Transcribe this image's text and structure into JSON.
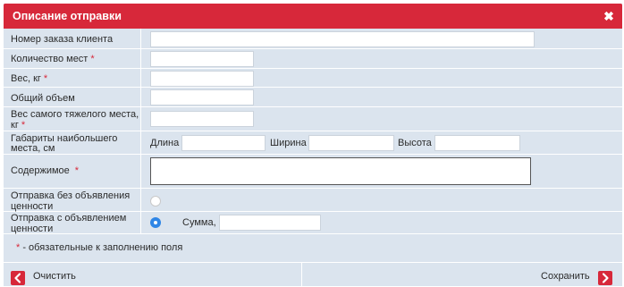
{
  "dialog": {
    "title": "Описание отправки",
    "close_symbol": "✖"
  },
  "fields": {
    "order_number_label": "Номер заказа клиента",
    "places_count_label": "Количество мест",
    "weight_label": "Вес, кг",
    "total_volume_label": "Общий объем",
    "heaviest_weight_label_line1": "Вес самого тяжелого места,",
    "heaviest_weight_label_line2": "кг",
    "dimensions_label_line1": "Габариты наибольшего",
    "dimensions_label_line2": "места, см",
    "length_label": "Длина",
    "width_label": "Ширина",
    "height_label": "Высота",
    "contents_label": "Содержимое",
    "no_value_label_line1": "Отправка без объявления",
    "no_value_label_line2": "ценности",
    "with_value_label_line1": "Отправка с объявлением",
    "with_value_label_line2": "ценности",
    "sum_label": "Сумма,",
    "required_star": "*"
  },
  "values": {
    "order_number": "",
    "places_count": "",
    "weight": "",
    "total_volume": "",
    "heaviest_weight": "",
    "length": "",
    "width": "",
    "height": "",
    "contents": "",
    "sum": ""
  },
  "selection": {
    "declared_value_option": "with_value"
  },
  "note": {
    "star": "*",
    "text": " - обязательные к заполнению поля"
  },
  "footer": {
    "clear_label": "Очистить",
    "save_label": "Сохранить"
  },
  "icons": {
    "close": "close-icon",
    "back": "arrow-left-icon",
    "forward": "arrow-right-icon"
  },
  "colors": {
    "accent": "#d7283a",
    "panel": "#dbe4ee",
    "radio_checked": "#2f86e6"
  }
}
